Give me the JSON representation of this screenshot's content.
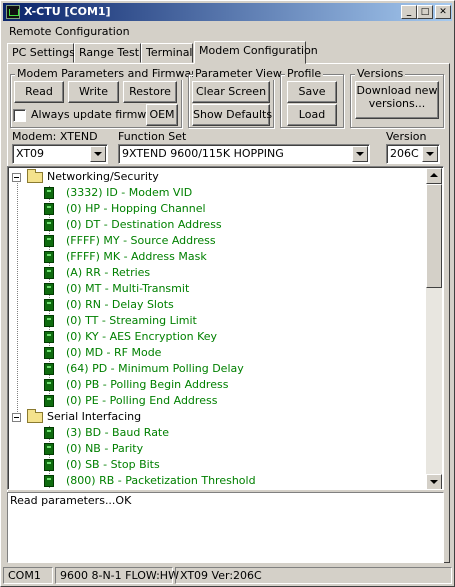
{
  "window": {
    "title": "X-CTU  [COM1]",
    "minimize_glyph": "_",
    "maximize_glyph": "□",
    "close_glyph": "✕"
  },
  "remote_config_label": "Remote Configuration",
  "tabs": [
    {
      "label": "PC Settings"
    },
    {
      "label": "Range Test"
    },
    {
      "label": "Terminal"
    },
    {
      "label": "Modem Configuration"
    }
  ],
  "groups": {
    "modem_params": {
      "title": "Modem Parameters and Firmware",
      "read": "Read",
      "write": "Write",
      "restore": "Restore",
      "always_update": "Always update firmware",
      "oem": "OEM"
    },
    "param_view": {
      "title": "Parameter View",
      "clear_screen": "Clear Screen",
      "show_defaults": "Show Defaults"
    },
    "profile": {
      "title": "Profile",
      "save": "Save",
      "load": "Load"
    },
    "versions": {
      "title": "Versions",
      "download_line1": "Download new",
      "download_line2": "versions..."
    }
  },
  "modem": {
    "label": "Modem: XTEND",
    "value": "XT09"
  },
  "function_set": {
    "label": "Function Set",
    "value": "9XTEND 9600/115K HOPPING"
  },
  "version": {
    "label": "Version",
    "value": "206C"
  },
  "tree": {
    "networking": {
      "label": "Networking/Security",
      "params": [
        "(3332) ID - Modem VID",
        "(0) HP - Hopping Channel",
        "(0) DT - Destination Address",
        "(FFFF) MY - Source Address",
        "(FFFF) MK - Address Mask",
        "(A) RR - Retries",
        "(0) MT - Multi-Transmit",
        "(0) RN - Delay Slots",
        "(0) TT - Streaming Limit",
        "(0) KY - AES Encryption Key",
        "(0) MD - RF Mode",
        "(64) PD - Minimum Polling Delay",
        "(0) PB - Polling Begin Address",
        "(0) PE - Polling End Address"
      ]
    },
    "serial": {
      "label": "Serial Interfacing",
      "params": [
        "(3) BD - Baud Rate",
        "(0) NB - Parity",
        "(0) SB - Stop Bits",
        "(800) RB - Packetization Threshold"
      ]
    }
  },
  "status_message": "Read parameters...OK",
  "statusbar": {
    "port": "COM1",
    "settings": "9600 8-N-1  FLOW:HW",
    "modem": "XT09  Ver:206C"
  }
}
